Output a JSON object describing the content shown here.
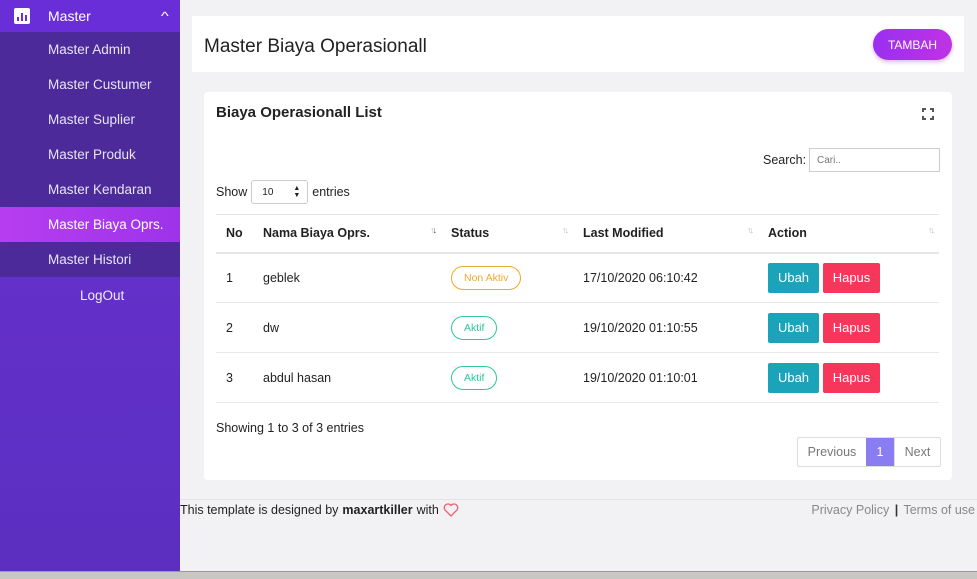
{
  "sidebar": {
    "header_label": "Master",
    "header_icon": "bar-chart-icon",
    "items": [
      {
        "label": "Master Admin"
      },
      {
        "label": "Master Custumer"
      },
      {
        "label": "Master Suplier"
      },
      {
        "label": "Master Produk"
      },
      {
        "label": "Master Kendaran"
      },
      {
        "label": "Master Biaya Oprs.",
        "active": true
      },
      {
        "label": "Master Histori"
      }
    ],
    "logout_label": "LogOut"
  },
  "header": {
    "title": "Master Biaya Operasionall",
    "add_button": "TAMBAH"
  },
  "card": {
    "title": "Biaya Operasionall List",
    "search_label": "Search:",
    "search_placeholder": "Cari..",
    "show_label": "Show",
    "entries_value": "10",
    "entries_label": "entries"
  },
  "table": {
    "columns": [
      "No",
      "Nama Biaya Oprs.",
      "Status",
      "Last Modified",
      "Action"
    ],
    "rows": [
      {
        "no": "1",
        "name": "geblek",
        "status": "Non Aktiv",
        "modified": "17/10/2020 06:10:42"
      },
      {
        "no": "2",
        "name": "dw",
        "status": "Aktif",
        "modified": "19/10/2020 01:10:55"
      },
      {
        "no": "3",
        "name": "abdul hasan",
        "status": "Aktif",
        "modified": "19/10/2020 01:10:01"
      }
    ],
    "edit_label": "Ubah",
    "delete_label": "Hapus"
  },
  "footer_info": "Showing 1 to 3 of 3 entries",
  "pagination": {
    "previous": "Previous",
    "current": "1",
    "next": "Next"
  },
  "footer": {
    "credit_prefix": "This template is designed by",
    "credit_author": "maxartkiller",
    "credit_suffix": "with",
    "privacy": "Privacy Policy",
    "separator": "|",
    "terms": "Terms of use"
  },
  "colors": {
    "accent": "#6a2fd6",
    "active": "#b73ef0",
    "ubah": "#1ba3ba",
    "hapus": "#f7365b",
    "aktif": "#2fc79b",
    "nonaktif": "#f0a831"
  }
}
